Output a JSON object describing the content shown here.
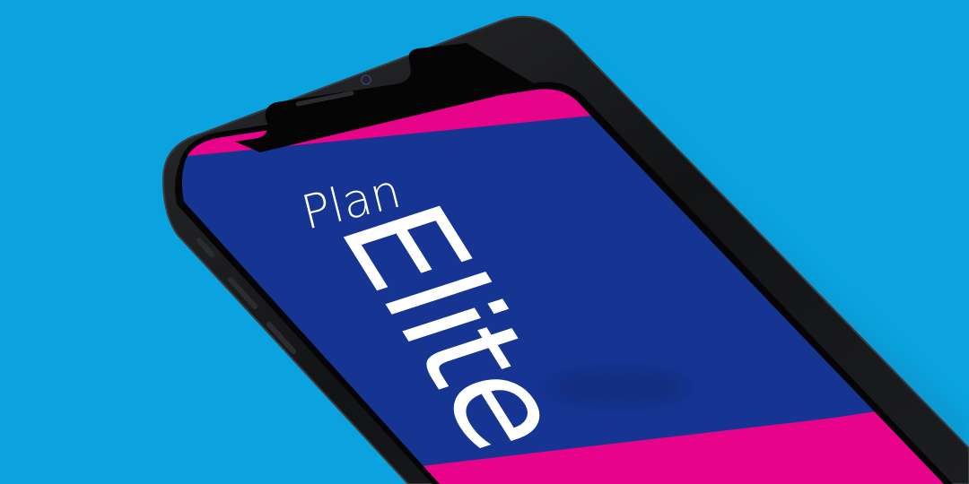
{
  "screen": {
    "title_line1": "Plan",
    "title_line2": "Elite"
  },
  "colors": {
    "background": "#0aa3df",
    "phone_body": "#151618",
    "screen_primary": "#163593",
    "screen_accent": "#e8038b",
    "text": "#ffffff"
  }
}
